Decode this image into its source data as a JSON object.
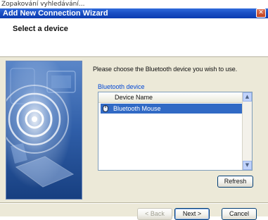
{
  "top_strip_text": "Zopakování vyhledávání...",
  "window": {
    "title": "Add New Connection Wizard",
    "controls": {
      "close_glyph": "✕"
    }
  },
  "header": {
    "title": "Select a device"
  },
  "body": {
    "instructions": "Please choose the Bluetooth device you wish to use.",
    "group_label": "Bluetooth device",
    "list": {
      "column_header": "Device Name",
      "rows": [
        {
          "label": "Bluetooth Mouse",
          "selected": true,
          "icon": "mouse-icon"
        }
      ],
      "scroll_up_glyph": "▲",
      "scroll_down_glyph": "▼"
    },
    "refresh_label": "Refresh"
  },
  "footer": {
    "back_label": "< Back",
    "next_label": "Next >",
    "cancel_label": "Cancel"
  },
  "colors": {
    "titlebar": "#1a4fc4",
    "selection": "#316ac5",
    "group_label": "#0046d5",
    "dialog_bg": "#ece9d8"
  }
}
